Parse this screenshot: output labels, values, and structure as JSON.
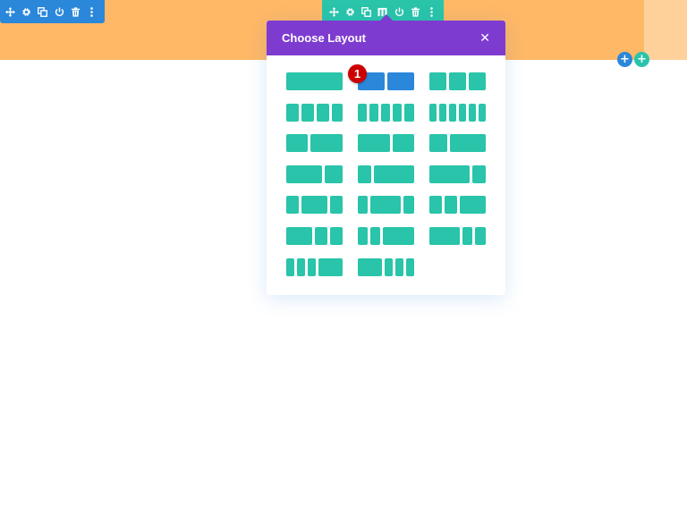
{
  "modal": {
    "title": "Choose Layout",
    "close_glyph": "✕"
  },
  "badge": {
    "number": "1"
  },
  "row_toolbar_icons": [
    "move-icon",
    "gear-icon",
    "duplicate-icon",
    "power-icon",
    "trash-icon",
    "more-icon"
  ],
  "section_toolbar_icons": [
    "move-icon",
    "gear-icon",
    "duplicate-icon",
    "columns-icon",
    "power-icon",
    "trash-icon",
    "more-icon"
  ],
  "add_buttons": {
    "glyph": "+"
  },
  "layouts": [
    {
      "name": "1-col",
      "cols": [
        1
      ]
    },
    {
      "name": "1/2+1/2",
      "cols": [
        1,
        1
      ],
      "selected": true
    },
    {
      "name": "1/3+1/3+1/3",
      "cols": [
        1,
        1,
        1
      ]
    },
    {
      "name": "4-col",
      "cols": [
        1,
        1,
        1,
        1
      ]
    },
    {
      "name": "5-col",
      "cols": [
        1,
        1,
        1,
        1,
        1
      ]
    },
    {
      "name": "6-col",
      "cols": [
        1,
        1,
        1,
        1,
        1,
        1
      ]
    },
    {
      "name": "2/5+3/5",
      "cols": [
        2,
        3
      ]
    },
    {
      "name": "3/5+2/5",
      "cols": [
        3,
        2
      ]
    },
    {
      "name": "1/3+2/3",
      "cols": [
        1,
        2
      ]
    },
    {
      "name": "2/3+1/3",
      "cols": [
        2,
        1
      ]
    },
    {
      "name": "1/4+3/4",
      "cols": [
        1,
        3
      ]
    },
    {
      "name": "3/4+1/4",
      "cols": [
        3,
        1
      ]
    },
    {
      "name": "1/4+1/2+1/4",
      "cols": [
        1,
        2,
        1
      ]
    },
    {
      "name": "1/5+3/5+1/5",
      "cols": [
        1,
        3,
        1
      ]
    },
    {
      "name": "1/4+1/4+1/2",
      "cols": [
        1,
        1,
        2
      ]
    },
    {
      "name": "1/2+1/4+1/4",
      "cols": [
        2,
        1,
        1
      ]
    },
    {
      "name": "1/5+1/5+3/5",
      "cols": [
        1,
        1,
        3
      ]
    },
    {
      "name": "3/5+1/5+1/5",
      "cols": [
        3,
        1,
        1
      ]
    },
    {
      "name": "1/6+1/6+1/6+1/2",
      "cols": [
        1,
        1,
        1,
        3
      ]
    },
    {
      "name": "1/2+1/6+1/6+1/6",
      "cols": [
        3,
        1,
        1,
        1
      ]
    }
  ],
  "colors": {
    "teal": "#29c4a9",
    "blue": "#2b87da",
    "purple": "#7e3bd0",
    "orange": "#ffb866"
  }
}
